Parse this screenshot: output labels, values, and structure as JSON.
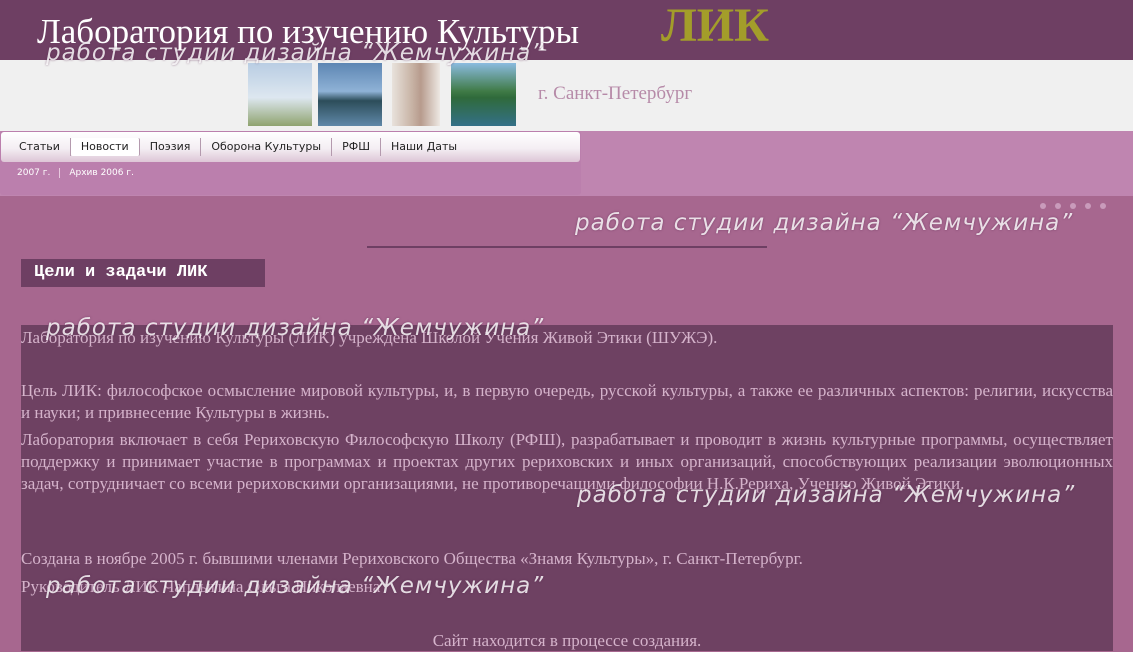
{
  "header": {
    "site_title": "Лаборатория по изучению Культуры",
    "brand": "ЛИК",
    "city": "г. Санкт-Петербург"
  },
  "nav": {
    "items": [
      {
        "label": "Статьи"
      },
      {
        "label": "Новости"
      },
      {
        "label": "Поэзия"
      },
      {
        "label": "Оборона Культуры"
      },
      {
        "label": "РФШ"
      },
      {
        "label": "Наши Даты"
      }
    ],
    "active_index": 1,
    "sub_items": [
      {
        "label": "2007 г."
      },
      {
        "label": "Архив 2006 г."
      }
    ]
  },
  "watermark": "работа студии дизайна “Жемчужина”",
  "section_title": "Цели и задачи ЛИК",
  "content": {
    "p1": "Лаборатория по изучению Культуры (ЛИК) учреждена Школой Учения Живой Этики (ШУЖЭ).",
    "p2": "Цель ЛИК: философское осмысление мировой культуры, и, в первую очередь, русской культуры, а также ее различных аспектов: религии, искусства и науки; и привнесение Культуры в жизнь.",
    "p3": "Лаборатория включает в себя Рериховскую Философскую Школу (РФШ), разрабатывает и проводит в жизнь культурные программы, осуществляет поддержку и принимает участие в программах и проектах других рериховских и иных организаций, способствующих реализации эволюционных задач, сотрудничает со всеми рериховскими организациями, не противоречащими философии Н.К.Рериха, Учению Живой Этики.",
    "p4": "Создана в ноябре 2005 г. бывшими членами Рериховского Общества «Знамя Культуры», г. Санкт-Петербург.",
    "p5": "Руководитель ЛИК Чаплыгина Ольга Николаевна",
    "p6": "Сайт находится в процессе создания."
  },
  "colors": {
    "header_bg": "#6e3f63",
    "brand": "#a39d2a",
    "page_bg": "#a7678f",
    "content_bg": "#6e4162",
    "content_text": "#d5b3cb"
  }
}
